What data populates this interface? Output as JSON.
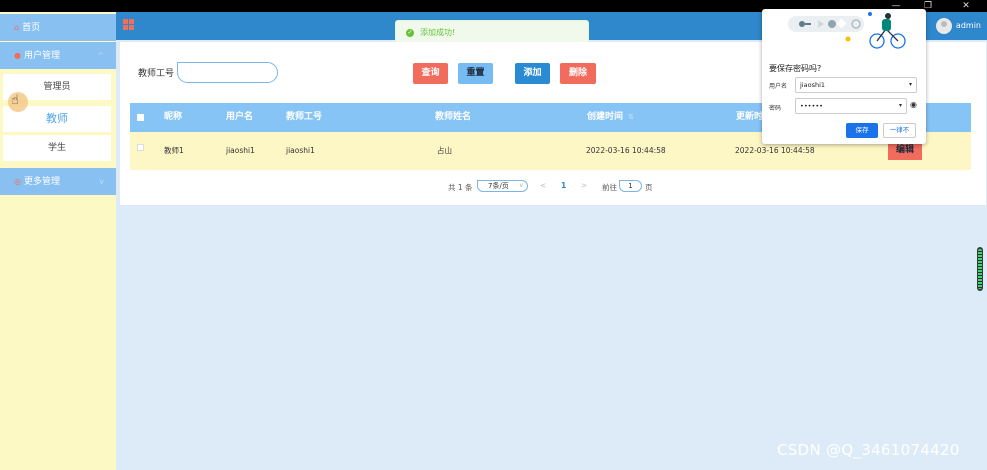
{
  "window": {
    "minimize": "—",
    "restore": "❐",
    "close": "✕"
  },
  "sidebar": {
    "home": "首页",
    "user_mgmt": "用户管理",
    "admin": "管理员",
    "teacher": "教师",
    "student": "学生",
    "more_mgmt": "更多管理"
  },
  "header": {
    "user": "admin"
  },
  "toast": {
    "message": "添加成功!"
  },
  "search": {
    "label": "教师工号",
    "value": ""
  },
  "toolbar": {
    "query": "查询",
    "reset": "重置",
    "add": "添加",
    "delete": "删除"
  },
  "table": {
    "headers": [
      "昵称",
      "用户名",
      "教师工号",
      "教师姓名",
      "创建时间",
      "更新时间"
    ],
    "rows": [
      {
        "nickname": "教师1",
        "username": "jiaoshi1",
        "teacher_id": "jiaoshi1",
        "teacher_name": "占山",
        "created": "2022-03-16 10:44:58",
        "updated": "2022-03-16 10:44:58",
        "edit": "编辑"
      }
    ]
  },
  "pagination": {
    "total": "共 1 条",
    "page_size": "7条/页",
    "current": "1",
    "goto_prefix": "前往",
    "goto_value": "1",
    "goto_suffix": "页"
  },
  "password_popup": {
    "title": "要保存密码吗?",
    "username_label": "用户名",
    "username_value": "jiaoshi1",
    "password_label": "密码",
    "password_value": "••••••",
    "save": "保存",
    "never": "一律不"
  },
  "watermark": "CSDN @Q_3461074420",
  "colors": {
    "accent": "#2f87cc",
    "sidebar_bg": "#fdf9c4",
    "menu_bg": "#89c0f2",
    "danger": "#f16c5d",
    "success": "#67c23a",
    "chrome_blue": "#1a73e8"
  }
}
